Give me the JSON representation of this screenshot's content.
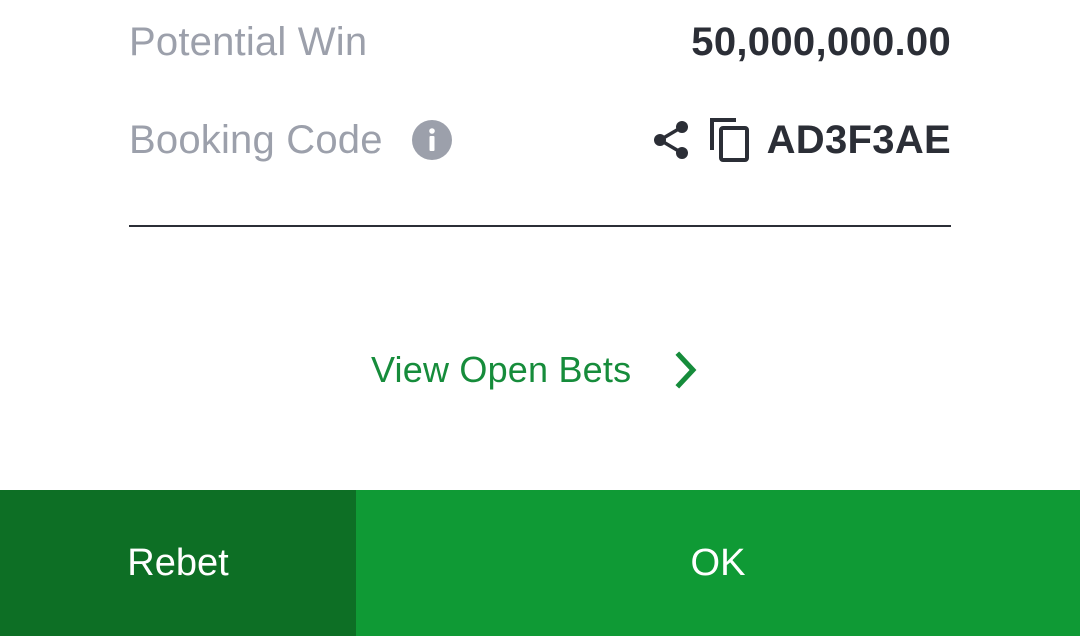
{
  "potential_win": {
    "label": "Potential Win",
    "value": "50,000,000.00"
  },
  "booking_code": {
    "label": "Booking Code",
    "code": "AD3F3AE",
    "info_icon": "info-icon",
    "share_icon": "share-icon",
    "copy_icon": "copy-icon"
  },
  "open_bets": {
    "label": "View Open Bets",
    "icon": "chevron-right-icon"
  },
  "footer": {
    "rebet_label": "Rebet",
    "ok_label": "OK"
  },
  "colors": {
    "label_gray": "#9ca0ab",
    "value_dark": "#2b2e36",
    "link_green": "#168c3b",
    "rebet_green": "#0d6f25",
    "ok_green": "#0f9a35"
  }
}
